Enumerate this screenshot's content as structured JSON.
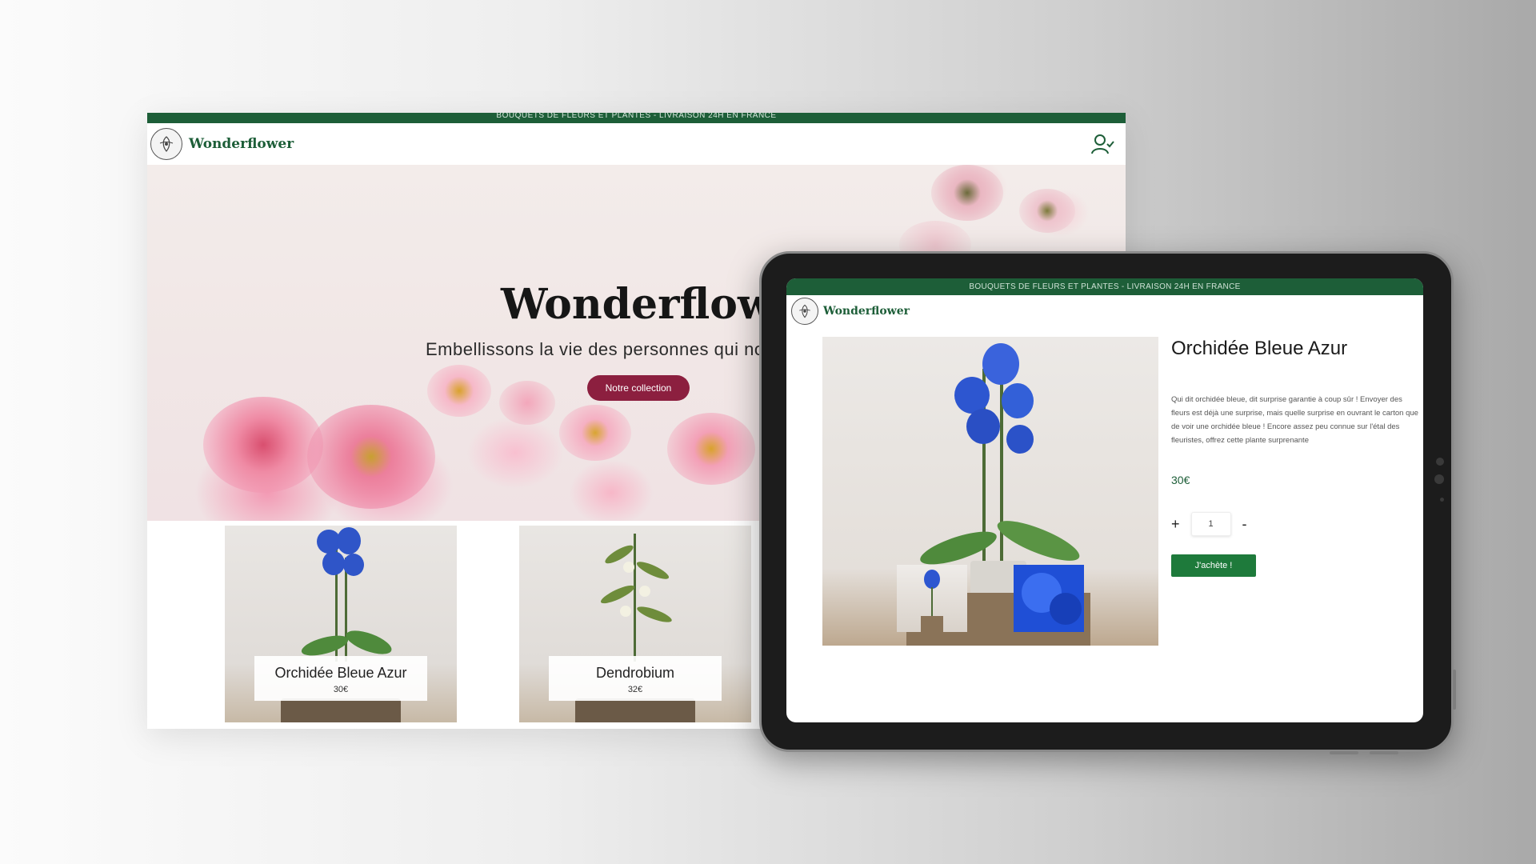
{
  "desktop": {
    "topbar_text": "BOUQUETS DE FLEURS ET PLANTES - LIVRAISON 24H EN FRANCE",
    "brand": "Wonderflower",
    "hero": {
      "title": "Wonderflower",
      "subtitle": "Embellissons la vie des personnes qui nous",
      "cta": "Notre collection"
    },
    "products": [
      {
        "name": "Orchidée Bleue Azur",
        "price": "30€"
      },
      {
        "name": "Dendrobium",
        "price": "32€"
      }
    ]
  },
  "tablet": {
    "topbar_text": "BOUQUETS DE FLEURS ET PLANTES - LIVRAISON 24H EN FRANCE",
    "brand": "Wonderflower",
    "product": {
      "title": "Orchidée Bleue Azur",
      "description": "Qui dit orchidée bleue, dit surprise garantie à coup sûr ! Envoyer des fleurs est déjà une surprise, mais quelle surprise en ouvrant le carton que de voir une orchidée bleue ! Encore assez peu connue sur l'étal des fleuristes, offrez cette plante surprenante",
      "price": "30€",
      "quantity": "1",
      "plus": "+",
      "minus": "-",
      "buy": "J'achète !"
    }
  },
  "colors": {
    "brand_green": "#1d5e38",
    "cta_burgundy": "#8c1f3f",
    "buy_green": "#1e7a3b"
  }
}
